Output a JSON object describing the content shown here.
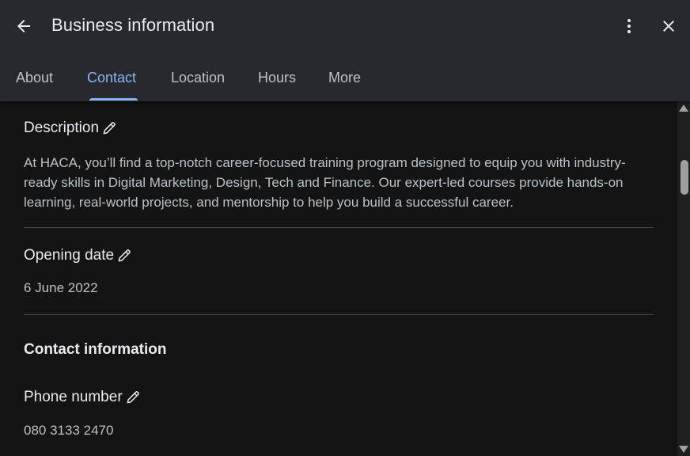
{
  "header": {
    "title": "Business information",
    "back_icon": "arrow-back-icon",
    "more_icon": "more-vert-icon",
    "close_icon": "close-icon"
  },
  "tabs": [
    {
      "label": "About",
      "active": false
    },
    {
      "label": "Contact",
      "active": true
    },
    {
      "label": "Location",
      "active": false
    },
    {
      "label": "Hours",
      "active": false
    },
    {
      "label": "More",
      "active": false
    }
  ],
  "content": {
    "description": {
      "label": "Description",
      "text": "At HACA, you’ll find a top-notch career-focused training program designed to equip you with industry-ready skills in Digital Marketing, Design, Tech and Finance. Our expert-led courses provide hands-on learning, real-world projects, and mentorship to help you build a successful career."
    },
    "opening_date": {
      "label": "Opening date",
      "value": "6 June 2022"
    },
    "contact_heading": "Contact information",
    "phone": {
      "label": "Phone number",
      "value": "080 3133 2470"
    }
  },
  "colors": {
    "header_bg": "#28292d",
    "content_bg": "#141414",
    "accent": "#8ab4f8",
    "primary_text": "#e8eaed",
    "secondary_text": "#bdc1c6"
  }
}
